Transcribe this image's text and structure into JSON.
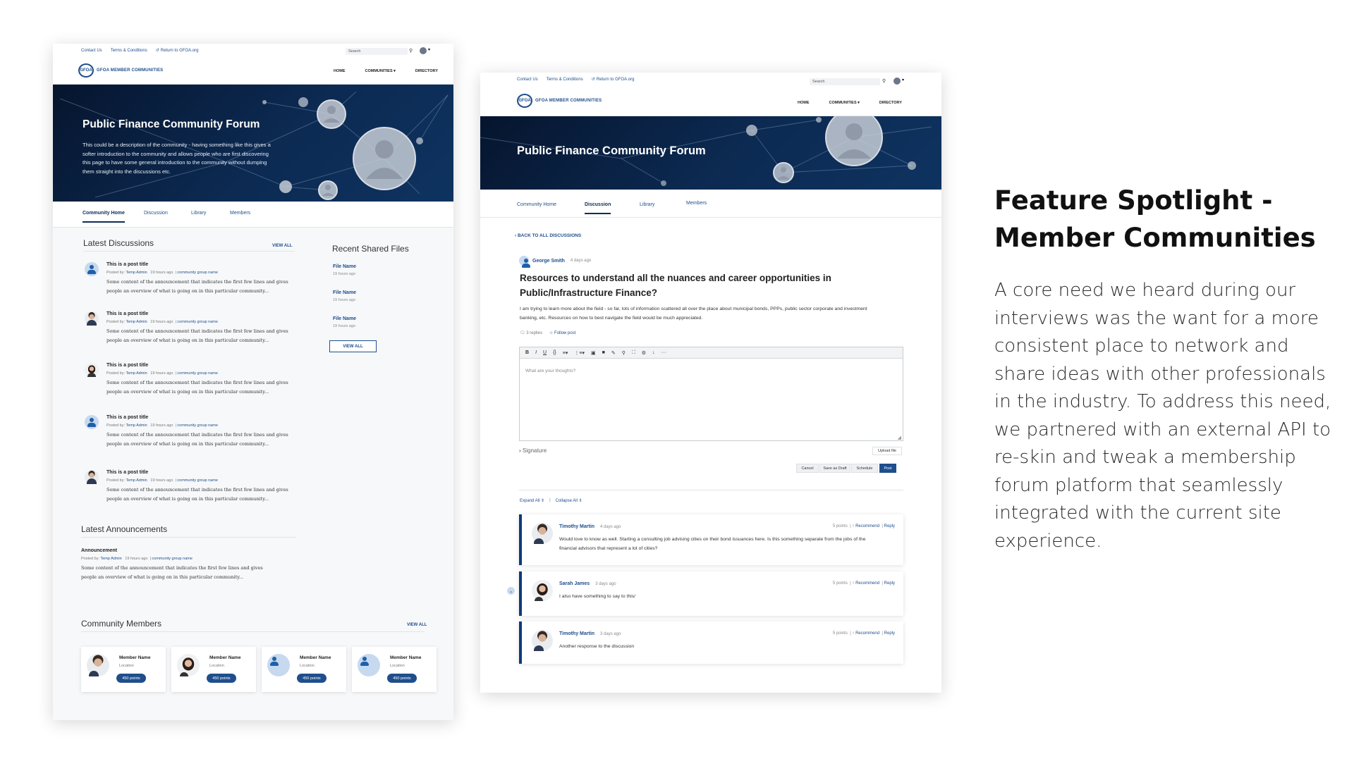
{
  "common": {
    "top_links": [
      "Contact Us",
      "Terms & Conditions",
      "Return to GFOA.org"
    ],
    "search_placeholder": "Search",
    "logo_text": "GFOA MEMBER COMMUNITIES",
    "logo_mark": "GFOA",
    "nav": [
      "HOME",
      "COMMUNITIES ▾",
      "DIRECTORY"
    ]
  },
  "community_page": {
    "hero_title": "Public Finance Community Forum",
    "hero_desc": "This could be a description of the community - having something like this gives a softer introduction to the community and allows people who are first discovering this page to have some general introduction to the community without dumping them straight into the discussions etc.",
    "tabs": [
      "Community Home",
      "Discussion",
      "Library",
      "Members"
    ],
    "latest_discussions": {
      "heading": "Latest Discussions",
      "view_all": "VIEW ALL",
      "posts": [
        {
          "title": "This is a post title",
          "posted_label": "Posted by:",
          "author": "Temp Admin",
          "time": "19 hours ago",
          "group": "community group name",
          "body": "Some content of the announcement that indicates the first few lines and gives people an overview of what is going on in this particular community..."
        },
        {
          "title": "This is a post title",
          "posted_label": "Posted by:",
          "author": "Temp Admin",
          "time": "19 hours ago",
          "group": "community group name",
          "body": "Some content of the announcement that indicates the first few lines and gives people an overview of what is going on in this particular community..."
        },
        {
          "title": "This is a post title",
          "posted_label": "Posted by:",
          "author": "Temp Admin",
          "time": "19 hours ago",
          "group": "community group name",
          "body": "Some content of the announcement that indicates the first few lines and gives people an overview of what is going on in this particular community..."
        },
        {
          "title": "This is a post title",
          "posted_label": "Posted by:",
          "author": "Temp Admin",
          "time": "19 hours ago",
          "group": "community group name",
          "body": "Some content of the announcement that indicates the first few lines and gives people an overview of what is going on in this particular community..."
        },
        {
          "title": "This is a post title",
          "posted_label": "Posted by:",
          "author": "Temp Admin",
          "time": "19 hours ago",
          "group": "community group name",
          "body": "Some content of the announcement that indicates the first few lines and gives people an overview of what is going on in this particular community..."
        }
      ]
    },
    "recent_files": {
      "heading": "Recent Shared Files",
      "files": [
        {
          "name": "File Name",
          "time": "19 hours ago"
        },
        {
          "name": "File Name",
          "time": "19 hours ago"
        },
        {
          "name": "File Name",
          "time": "19 hours ago"
        }
      ],
      "view_all": "VIEW ALL"
    },
    "announcements": {
      "heading": "Latest Announcements",
      "title": "Announcement",
      "posted_label": "Posted by:",
      "author": "Temp Admin",
      "time": "19 hours ago",
      "group": "community group name",
      "body": "Some content of the announcement that indicates the first few lines and gives people an overview of what is going on in this particular community..."
    },
    "members": {
      "heading": "Community Members",
      "view_all": "VIEW ALL",
      "items": [
        {
          "name": "Member Name",
          "location": "Location",
          "points": "450 points"
        },
        {
          "name": "Member Name",
          "location": "Location",
          "points": "450 points"
        },
        {
          "name": "Member Name",
          "location": "Location",
          "points": "450 points"
        },
        {
          "name": "Member Name",
          "location": "Location",
          "points": "450 points"
        }
      ]
    }
  },
  "discussion_page": {
    "hero_title": "Public Finance Community Forum",
    "tabs": [
      "Community Home",
      "Discussion",
      "Library",
      "Members"
    ],
    "back_link": "BACK TO ALL DISCUSSIONS",
    "author": "George Smith",
    "author_time": "4 days ago",
    "question_title": "Resources to understand all the nuances and career opportunities in Public/Infrastructure Finance?",
    "question_body": "I am trying to learn more about the field - so far, lots of information scattered all over the place about municipal bonds, PPPs, public sector corporate and investment banking, etc. Resources on how to best navigate the field would be much appreciated.",
    "replies_count": "3 replies",
    "follow_post": "Follow post",
    "editor_placeholder": "What are your thoughts?",
    "toolbar": [
      "B",
      "I",
      "U",
      "{}",
      "≡▾",
      "⋮≡▾",
      "▣",
      "■",
      "✎",
      "⚲",
      "⛶",
      "⚙",
      "↓",
      "···"
    ],
    "signature": "Signature",
    "upload_file": "Upload file",
    "buttons": {
      "cancel": "Cancel",
      "save_draft": "Save as Draft",
      "schedule": "Schedule",
      "post": "Post"
    },
    "expand_all": "Expand All",
    "collapse_all": "Collapse All",
    "replies": [
      {
        "name": "Timothy Martin",
        "time": "4 days ago",
        "points": "5 points",
        "recommend": "Recommend",
        "reply": "Reply",
        "text": "Would love to know as well. Starting a consulting job advising cities on their bond issuances here. Is this something separate from the jobs of the financial advisors that represent a lot of cities?"
      },
      {
        "name": "Sarah James",
        "time": "3 days ago",
        "points": "5 points",
        "recommend": "Recommend",
        "reply": "Reply",
        "text": "I also have something to say to this/"
      },
      {
        "name": "Timothy Martin",
        "time": "3 days ago",
        "points": "5 points",
        "recommend": "Recommend",
        "reply": "Reply",
        "text": "Another response to the discussion"
      }
    ]
  },
  "feature": {
    "title": "Feature Spotlight - Member Communities",
    "body": "A core need we heard during our interviews was the want for a more consistent place to network and share ideas with other professionals in the industry. To address this need, we partnered with an external API to re-skin and tweak a membership forum platform that seamlessly integrated with the current site experience."
  },
  "colors": {
    "brand": "#1f4e8c",
    "hero_dark": "#06152e",
    "accent_border": "#0d3a78"
  }
}
